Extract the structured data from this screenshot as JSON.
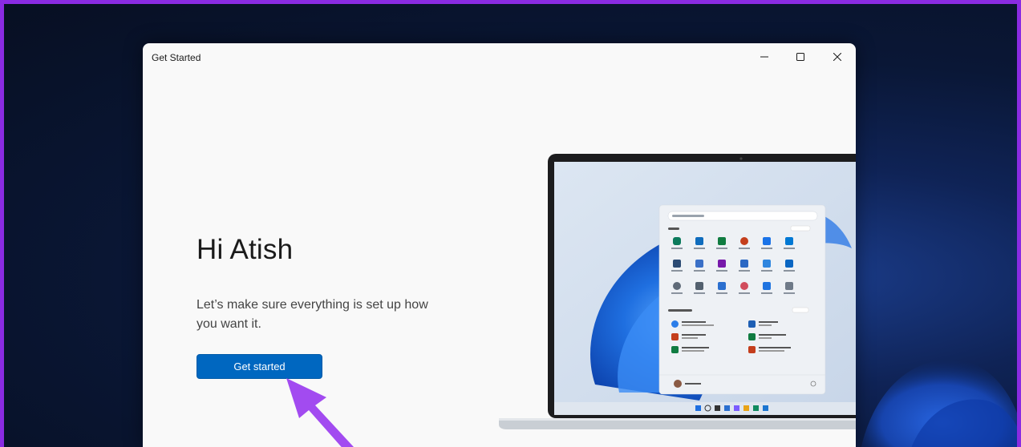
{
  "window": {
    "title": "Get Started",
    "minimize_icon": "minimize-icon",
    "maximize_icon": "maximize-icon",
    "close_icon": "close-icon"
  },
  "main": {
    "greeting": "Hi Atish",
    "subtitle": "Let’s make sure everything is set up how you want it.",
    "get_started_label": "Get started"
  },
  "colors": {
    "accent": "#0067c0",
    "annotation_arrow": "#a24bf0",
    "frame_border": "#8a2be2"
  }
}
